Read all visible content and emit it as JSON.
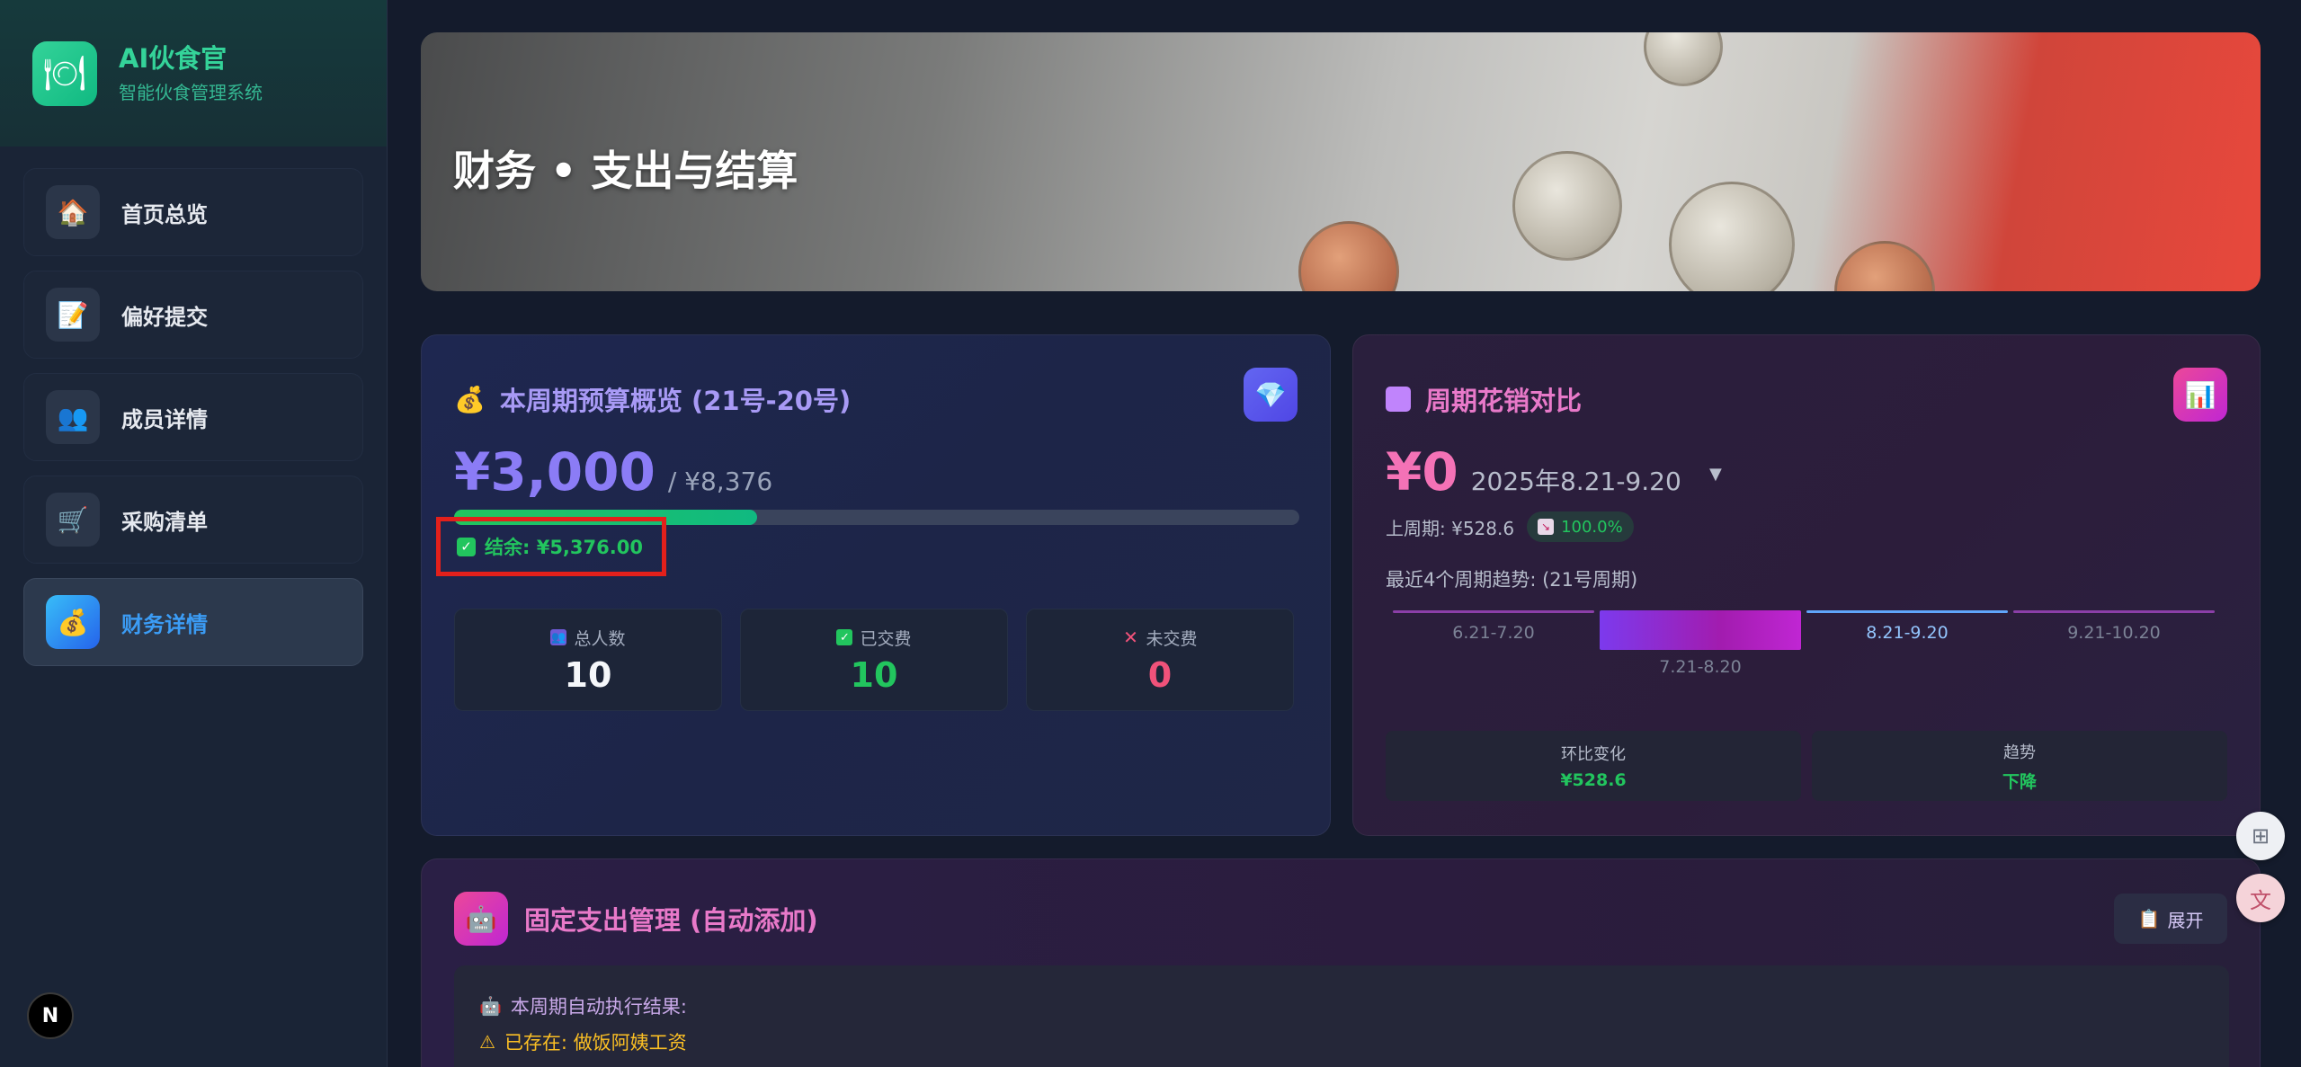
{
  "brand": {
    "title": "AI伙食官",
    "subtitle": "智能伙食管理系统",
    "logo_icon": "plate-icon"
  },
  "nav": [
    {
      "label": "首页总览",
      "icon": "house-icon",
      "glyph": "🏠",
      "active": false
    },
    {
      "label": "偏好提交",
      "icon": "document-icon",
      "glyph": "📝",
      "active": false
    },
    {
      "label": "成员详情",
      "icon": "people-icon",
      "glyph": "👥",
      "active": false
    },
    {
      "label": "采购清单",
      "icon": "cart-icon",
      "glyph": "🛒",
      "active": false
    },
    {
      "label": "财务详情",
      "icon": "moneybag-icon",
      "glyph": "💰",
      "active": true
    }
  ],
  "hero": {
    "title": "财务 • 支出与结算"
  },
  "budget": {
    "title": "本周期预算概览 (21号-20号)",
    "amount": "¥3,000",
    "total": "/ ¥8,376",
    "progress": 0.358,
    "balance": "结余: ¥5,376.00",
    "stats": [
      {
        "label": "总人数",
        "value": "10"
      },
      {
        "label": "已交费",
        "value": "10"
      },
      {
        "label": "未交费",
        "value": "0"
      }
    ]
  },
  "compare": {
    "title": "周期花销对比",
    "amount": "¥0",
    "period": "2025年8.21-9.20",
    "select_arrow": "▼",
    "last_period": "上周期: ¥528.6",
    "change_pct": "100.0%",
    "trend_title": "最近4个周期趋势: (21号周期)",
    "trend": [
      "6.21-7.20",
      "7.21-8.20",
      "8.21-9.20",
      "9.21-10.20"
    ],
    "summary": [
      {
        "label": "环比变化",
        "value": "¥528.6"
      },
      {
        "label": "趋势",
        "value": "下降"
      }
    ]
  },
  "fixed": {
    "title": "固定支出管理 (自动添加)",
    "expand": "展开",
    "result_title": "本周期自动执行结果:",
    "result_item": "已存在: 做饭阿姨工资"
  },
  "colors": {
    "accent_green": "#22c55e",
    "accent_purple": "#8b7cf6",
    "accent_pink": "#f472b6",
    "highlight_red": "#e3201b"
  }
}
